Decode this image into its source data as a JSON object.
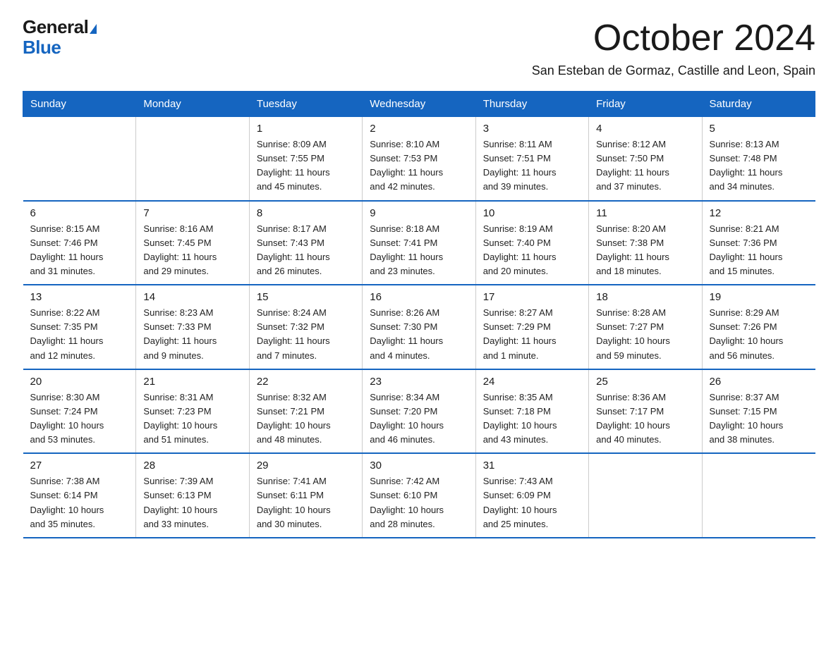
{
  "header": {
    "logo_general": "General",
    "logo_blue": "Blue",
    "title": "October 2024",
    "subtitle": "San Esteban de Gormaz, Castille and Leon, Spain"
  },
  "days_of_week": [
    "Sunday",
    "Monday",
    "Tuesday",
    "Wednesday",
    "Thursday",
    "Friday",
    "Saturday"
  ],
  "weeks": [
    [
      {
        "day": "",
        "info": ""
      },
      {
        "day": "",
        "info": ""
      },
      {
        "day": "1",
        "info": "Sunrise: 8:09 AM\nSunset: 7:55 PM\nDaylight: 11 hours\nand 45 minutes."
      },
      {
        "day": "2",
        "info": "Sunrise: 8:10 AM\nSunset: 7:53 PM\nDaylight: 11 hours\nand 42 minutes."
      },
      {
        "day": "3",
        "info": "Sunrise: 8:11 AM\nSunset: 7:51 PM\nDaylight: 11 hours\nand 39 minutes."
      },
      {
        "day": "4",
        "info": "Sunrise: 8:12 AM\nSunset: 7:50 PM\nDaylight: 11 hours\nand 37 minutes."
      },
      {
        "day": "5",
        "info": "Sunrise: 8:13 AM\nSunset: 7:48 PM\nDaylight: 11 hours\nand 34 minutes."
      }
    ],
    [
      {
        "day": "6",
        "info": "Sunrise: 8:15 AM\nSunset: 7:46 PM\nDaylight: 11 hours\nand 31 minutes."
      },
      {
        "day": "7",
        "info": "Sunrise: 8:16 AM\nSunset: 7:45 PM\nDaylight: 11 hours\nand 29 minutes."
      },
      {
        "day": "8",
        "info": "Sunrise: 8:17 AM\nSunset: 7:43 PM\nDaylight: 11 hours\nand 26 minutes."
      },
      {
        "day": "9",
        "info": "Sunrise: 8:18 AM\nSunset: 7:41 PM\nDaylight: 11 hours\nand 23 minutes."
      },
      {
        "day": "10",
        "info": "Sunrise: 8:19 AM\nSunset: 7:40 PM\nDaylight: 11 hours\nand 20 minutes."
      },
      {
        "day": "11",
        "info": "Sunrise: 8:20 AM\nSunset: 7:38 PM\nDaylight: 11 hours\nand 18 minutes."
      },
      {
        "day": "12",
        "info": "Sunrise: 8:21 AM\nSunset: 7:36 PM\nDaylight: 11 hours\nand 15 minutes."
      }
    ],
    [
      {
        "day": "13",
        "info": "Sunrise: 8:22 AM\nSunset: 7:35 PM\nDaylight: 11 hours\nand 12 minutes."
      },
      {
        "day": "14",
        "info": "Sunrise: 8:23 AM\nSunset: 7:33 PM\nDaylight: 11 hours\nand 9 minutes."
      },
      {
        "day": "15",
        "info": "Sunrise: 8:24 AM\nSunset: 7:32 PM\nDaylight: 11 hours\nand 7 minutes."
      },
      {
        "day": "16",
        "info": "Sunrise: 8:26 AM\nSunset: 7:30 PM\nDaylight: 11 hours\nand 4 minutes."
      },
      {
        "day": "17",
        "info": "Sunrise: 8:27 AM\nSunset: 7:29 PM\nDaylight: 11 hours\nand 1 minute."
      },
      {
        "day": "18",
        "info": "Sunrise: 8:28 AM\nSunset: 7:27 PM\nDaylight: 10 hours\nand 59 minutes."
      },
      {
        "day": "19",
        "info": "Sunrise: 8:29 AM\nSunset: 7:26 PM\nDaylight: 10 hours\nand 56 minutes."
      }
    ],
    [
      {
        "day": "20",
        "info": "Sunrise: 8:30 AM\nSunset: 7:24 PM\nDaylight: 10 hours\nand 53 minutes."
      },
      {
        "day": "21",
        "info": "Sunrise: 8:31 AM\nSunset: 7:23 PM\nDaylight: 10 hours\nand 51 minutes."
      },
      {
        "day": "22",
        "info": "Sunrise: 8:32 AM\nSunset: 7:21 PM\nDaylight: 10 hours\nand 48 minutes."
      },
      {
        "day": "23",
        "info": "Sunrise: 8:34 AM\nSunset: 7:20 PM\nDaylight: 10 hours\nand 46 minutes."
      },
      {
        "day": "24",
        "info": "Sunrise: 8:35 AM\nSunset: 7:18 PM\nDaylight: 10 hours\nand 43 minutes."
      },
      {
        "day": "25",
        "info": "Sunrise: 8:36 AM\nSunset: 7:17 PM\nDaylight: 10 hours\nand 40 minutes."
      },
      {
        "day": "26",
        "info": "Sunrise: 8:37 AM\nSunset: 7:15 PM\nDaylight: 10 hours\nand 38 minutes."
      }
    ],
    [
      {
        "day": "27",
        "info": "Sunrise: 7:38 AM\nSunset: 6:14 PM\nDaylight: 10 hours\nand 35 minutes."
      },
      {
        "day": "28",
        "info": "Sunrise: 7:39 AM\nSunset: 6:13 PM\nDaylight: 10 hours\nand 33 minutes."
      },
      {
        "day": "29",
        "info": "Sunrise: 7:41 AM\nSunset: 6:11 PM\nDaylight: 10 hours\nand 30 minutes."
      },
      {
        "day": "30",
        "info": "Sunrise: 7:42 AM\nSunset: 6:10 PM\nDaylight: 10 hours\nand 28 minutes."
      },
      {
        "day": "31",
        "info": "Sunrise: 7:43 AM\nSunset: 6:09 PM\nDaylight: 10 hours\nand 25 minutes."
      },
      {
        "day": "",
        "info": ""
      },
      {
        "day": "",
        "info": ""
      }
    ]
  ]
}
